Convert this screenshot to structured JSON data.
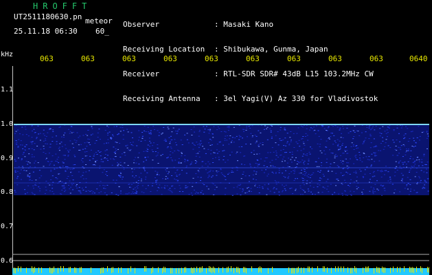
{
  "header": {
    "brand": "HROFFT",
    "filename": "UT2511180630.pn",
    "mode": "meteor",
    "datetime": "25.11.18 06:30",
    "minutes": "60_",
    "info": [
      {
        "label": "Observer",
        "value": "Masaki Kano"
      },
      {
        "label": "Receiving Location",
        "value": "Shibukawa, Gunma, Japan"
      },
      {
        "label": "Receiver",
        "value": "RTL-SDR SDR# 43dB L15 103.2MHz CW"
      },
      {
        "label": "Receiving Antenna",
        "value": "3el Yagi(V) Az 330 for Vladivostok"
      }
    ]
  },
  "axis": {
    "y_unit": "kHz",
    "y_ticks": [
      "1.1",
      "1.0",
      "0.9",
      "0.8",
      "0.7",
      "0.6"
    ],
    "x_ticks": [
      "063",
      "063",
      "063",
      "063",
      "063",
      "063",
      "063",
      "063",
      "063",
      "0640"
    ]
  },
  "colors": {
    "background": "#000000",
    "text": "#ffffff",
    "accent_green": "#24c86c",
    "tick_yellow": "#e8e800",
    "noise_blue": "#1e3cff",
    "carrier_cyan": "#7fd8ff"
  }
}
